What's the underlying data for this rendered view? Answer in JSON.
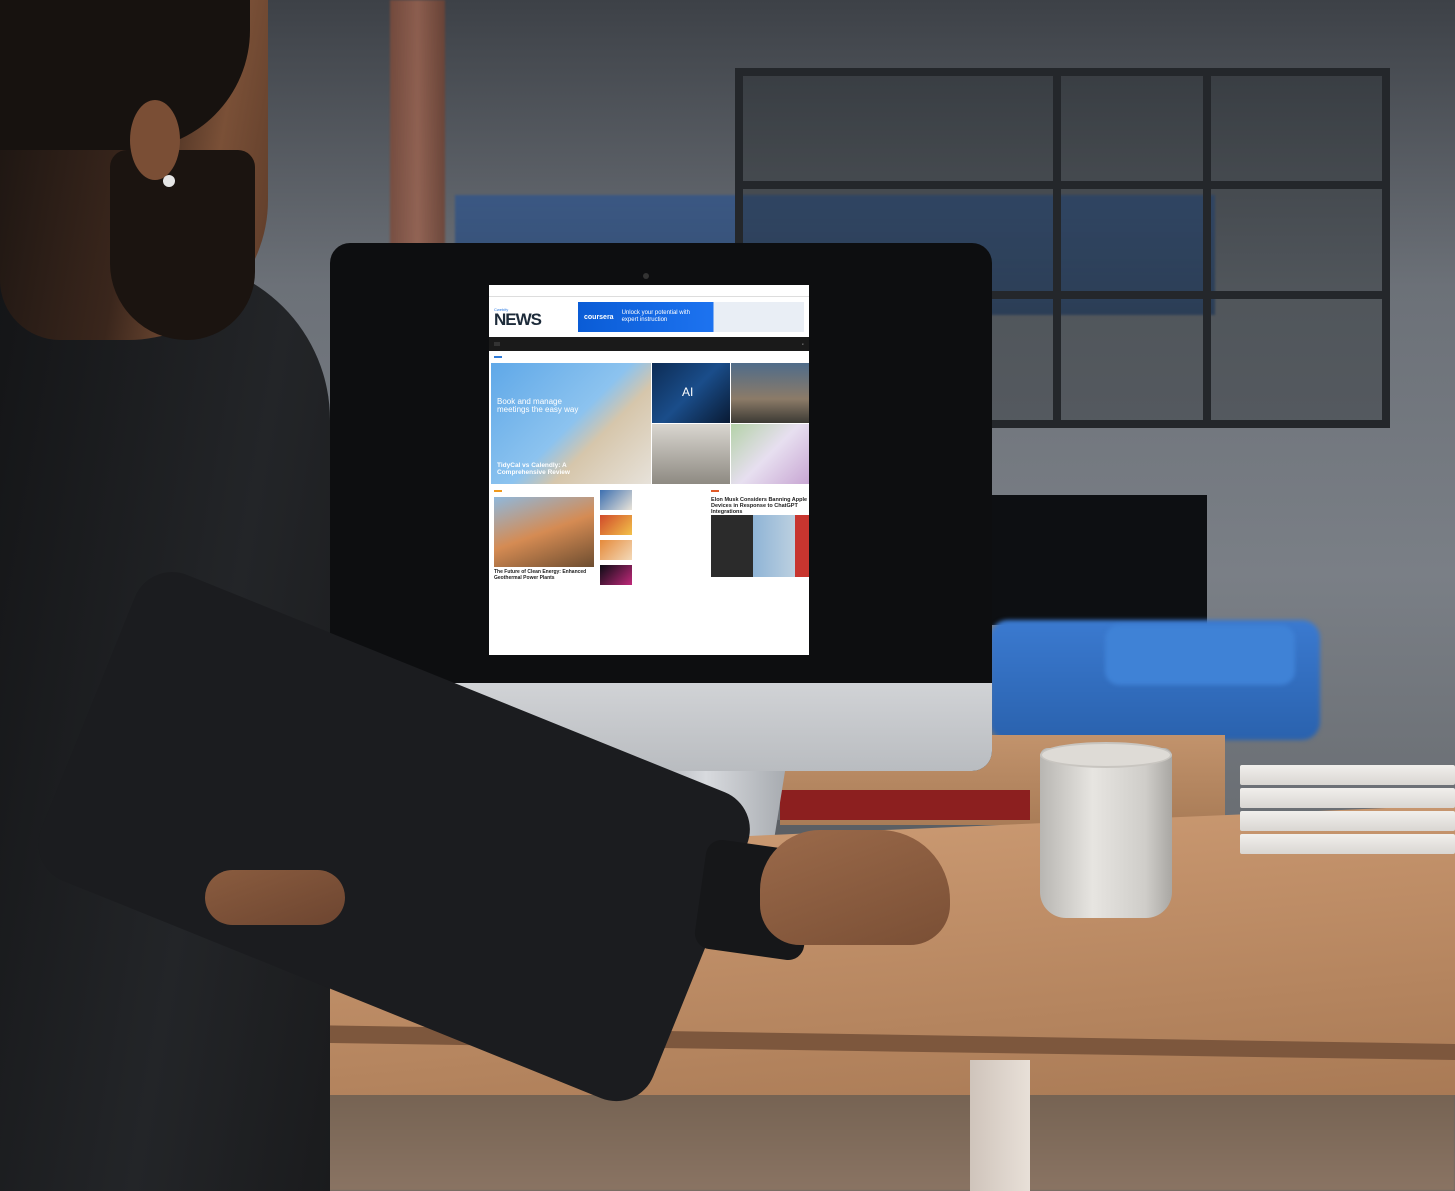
{
  "website": {
    "topbar": {
      "items": [
        "",
        "",
        "",
        "",
        ""
      ]
    },
    "logo": {
      "subtitle": "Cwebify",
      "title": "NEWS"
    },
    "ad": {
      "brand": "coursera",
      "text": "Unlock your potential with expert instruction"
    },
    "nav": {
      "items": [
        "",
        "",
        "",
        "",
        "",
        "",
        "",
        ""
      ]
    },
    "ticker": {
      "tag": "",
      "text": ""
    },
    "hero": {
      "tile_banner_title": "Book and manage meetings the easy way",
      "tile_caption": "TidyCal vs Calendly: A Comprehensive Review",
      "ai_label": "AI"
    },
    "feature": {
      "title": "The Future of Clean Energy: Enhanced Geothermal Power Plants"
    },
    "right": {
      "title": "Elon Musk Considers Banning Apple Devices in Response to ChatGPT Integrations"
    }
  }
}
